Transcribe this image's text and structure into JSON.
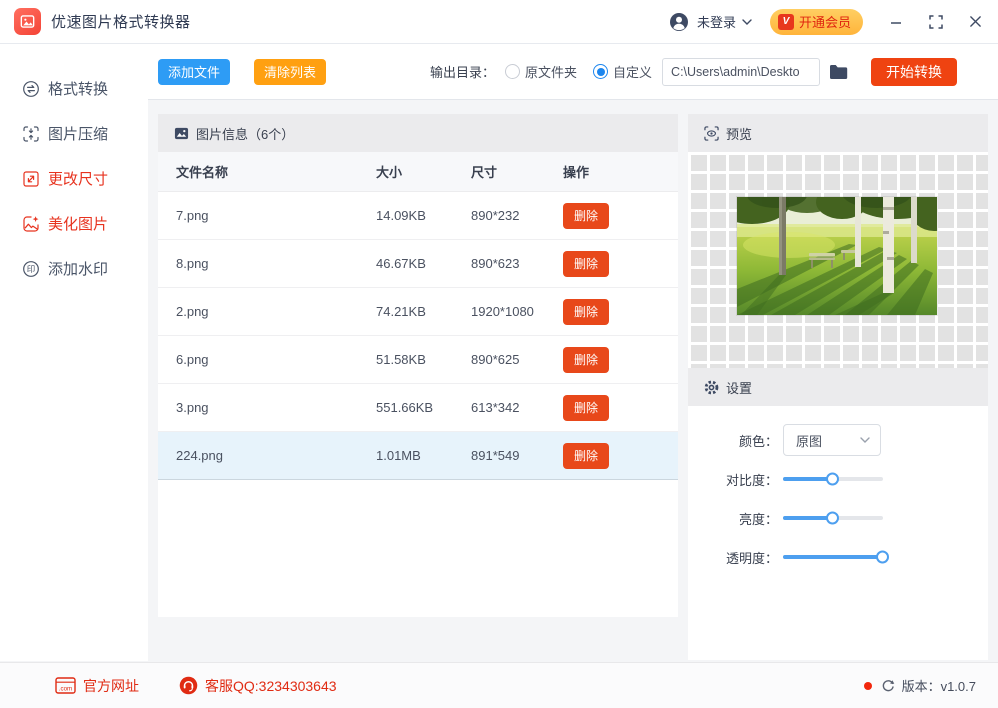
{
  "titlebar": {
    "app_title": "优速图片格式转换器",
    "login_label": "未登录",
    "vip_icon": "V",
    "vip_label": "开通会员"
  },
  "toolbar": {
    "add_files": "添加文件",
    "clear_list": "清除列表",
    "output_dir_label": "输出目录：",
    "radio_original": "原文件夹",
    "radio_custom": "自定义",
    "path_value": "C:\\Users\\admin\\Deskto",
    "start_convert": "开始转换"
  },
  "sidebar": {
    "watermark_icon_char": "印",
    "items": [
      {
        "label": "格式转换",
        "active": false
      },
      {
        "label": "图片压缩",
        "active": false
      },
      {
        "label": "更改尺寸",
        "active": true
      },
      {
        "label": "美化图片",
        "active": true
      },
      {
        "label": "添加水印",
        "active": false
      }
    ]
  },
  "file_panel": {
    "title": "图片信息（6个）",
    "columns": {
      "name": "文件名称",
      "size": "大小",
      "dim": "尺寸",
      "ops": "操作"
    },
    "delete_label": "删除",
    "rows": [
      {
        "name": "7.png",
        "size": "14.09KB",
        "dim": "890*232",
        "selected": false
      },
      {
        "name": "8.png",
        "size": "46.67KB",
        "dim": "890*623",
        "selected": false
      },
      {
        "name": "2.png",
        "size": "74.21KB",
        "dim": "1920*1080",
        "selected": false
      },
      {
        "name": "6.png",
        "size": "51.58KB",
        "dim": "890*625",
        "selected": false
      },
      {
        "name": "3.png",
        "size": "551.66KB",
        "dim": "613*342",
        "selected": false
      },
      {
        "name": "224.png",
        "size": "1.01MB",
        "dim": "891*549",
        "selected": true
      }
    ]
  },
  "preview_panel": {
    "title": "预览"
  },
  "settings_panel": {
    "title": "设置",
    "color_label": "颜色：",
    "color_value": "原图",
    "sliders": [
      {
        "label": "对比度：",
        "percent": 50
      },
      {
        "label": "亮度：",
        "percent": 50
      },
      {
        "label": "透明度：",
        "percent": 100
      }
    ]
  },
  "statusbar": {
    "com_icon_text": ".com",
    "website": "官方网址",
    "qq": "客服QQ:3234303643",
    "version_label": "版本：v1.0.7"
  },
  "colors": {
    "brand_red": "#f44336",
    "accent_blue": "#2e9cf5",
    "accent_orange": "#ffa011",
    "start_orange_red": "#ef4311",
    "delete_red": "#e8481a",
    "active_red": "#e7331f",
    "vip_pill": "#ffbe45",
    "selected_row": "#e7f3fb",
    "slider_blue": "#4d9fef",
    "status_red": "#e02b13"
  }
}
